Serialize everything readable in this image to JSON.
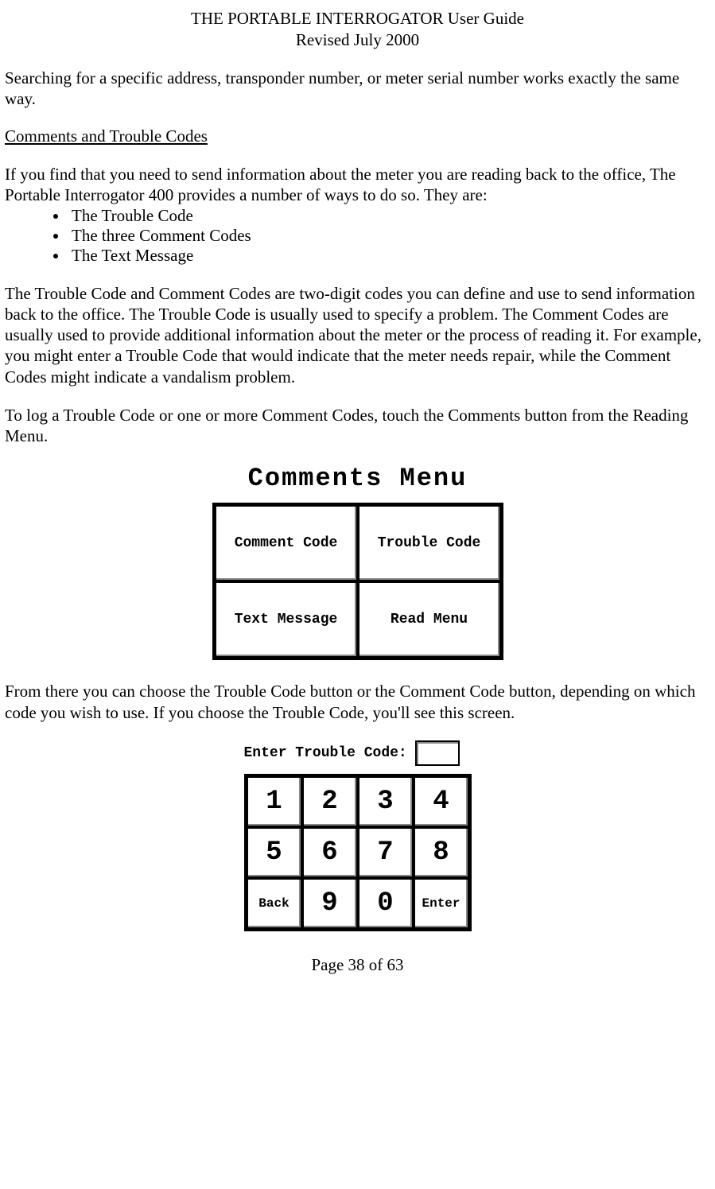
{
  "header": {
    "title": "THE PORTABLE INTERROGATOR User Guide",
    "revised": "Revised July 2000"
  },
  "paragraphs": {
    "intro": "Searching for a specific address, transponder number, or meter serial number works exactly the same way.",
    "section_title": "Comments and Trouble Codes",
    "p1": "If you find that you need to send information about the meter you are reading back to the office, The Portable Interrogator 400 provides a number of ways to do so.  They are:",
    "p2": "The Trouble Code and Comment Codes are two-digit codes you can define and use to send information back to the office.  The Trouble Code is usually used to specify a problem.  The Comment Codes are usually used to provide additional information about the meter or the process of reading it.  For example, you might enter a Trouble Code that would indicate that the meter needs repair, while the Comment Codes might indicate a vandalism problem.",
    "p3": "To log a Trouble Code or one or more Comment Codes, touch the Comments button from the Reading Menu.",
    "p4": "From there you can choose the Trouble Code button or the Comment Code button, depending on which code you wish to use.  If you choose the Trouble Code, you'll see this screen."
  },
  "bullets": [
    "The Trouble Code",
    "The three Comment Codes",
    "The Text Message"
  ],
  "comments_menu": {
    "title": "Comments Menu",
    "buttons": [
      "Comment Code",
      "Trouble Code",
      "Text Message",
      "Read Menu"
    ]
  },
  "trouble_code": {
    "prompt": "Enter Trouble Code:",
    "keys": [
      "1",
      "2",
      "3",
      "4",
      "5",
      "6",
      "7",
      "8",
      "Back",
      "9",
      "0",
      "Enter"
    ]
  },
  "footer": {
    "page": "Page 38 of 63"
  }
}
